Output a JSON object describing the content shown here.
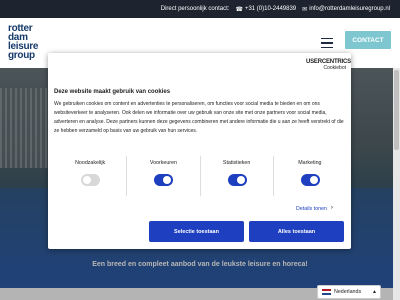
{
  "topbar": {
    "label": "Direct persoonlijk contact:",
    "phone": "+31 (0)10-2449839",
    "email": "info@rotterdamleisuregroup.nl"
  },
  "header": {
    "logo_lines": [
      "rotter",
      "dam",
      "leisure",
      "group"
    ],
    "contact_label": "CONTACT"
  },
  "hero": {
    "tagline": "Een breed en compleet aanbod van de leukste leisure en horeca!"
  },
  "consent": {
    "title": "Deze website maakt gebruik van cookies",
    "brand_name": "USERCENTRICS",
    "brand_sub": "Cookiebot",
    "body": "We gebruiken cookies om content en advertenties te personaliseren, om functies voor social media te bieden en om ons websiteverkeer te analyseren. Ook delen we informatie over uw gebruik van onze site met onze partners voor social media, adverteren en analyse. Deze partners kunnen deze gegevens combineren met andere informatie die u aan ze heeft verstrekt of die ze hebben verzameld op basis van uw gebruik van hun services.",
    "toggles": [
      {
        "label": "Noodzakelijk",
        "state": "off"
      },
      {
        "label": "Voorkeuren",
        "state": "on"
      },
      {
        "label": "Statistieken",
        "state": "on"
      },
      {
        "label": "Marketing",
        "state": "on"
      }
    ],
    "details_label": "Details tonen",
    "select_label": "Selectie toestaan",
    "allow_all_label": "Alles toestaan"
  },
  "language": {
    "selected": "Nederlands"
  },
  "colors": {
    "accent": "#1d3fc0",
    "contact_button": "#7ec7d0",
    "topbar": "#1d2430",
    "logo": "#163a6b"
  }
}
